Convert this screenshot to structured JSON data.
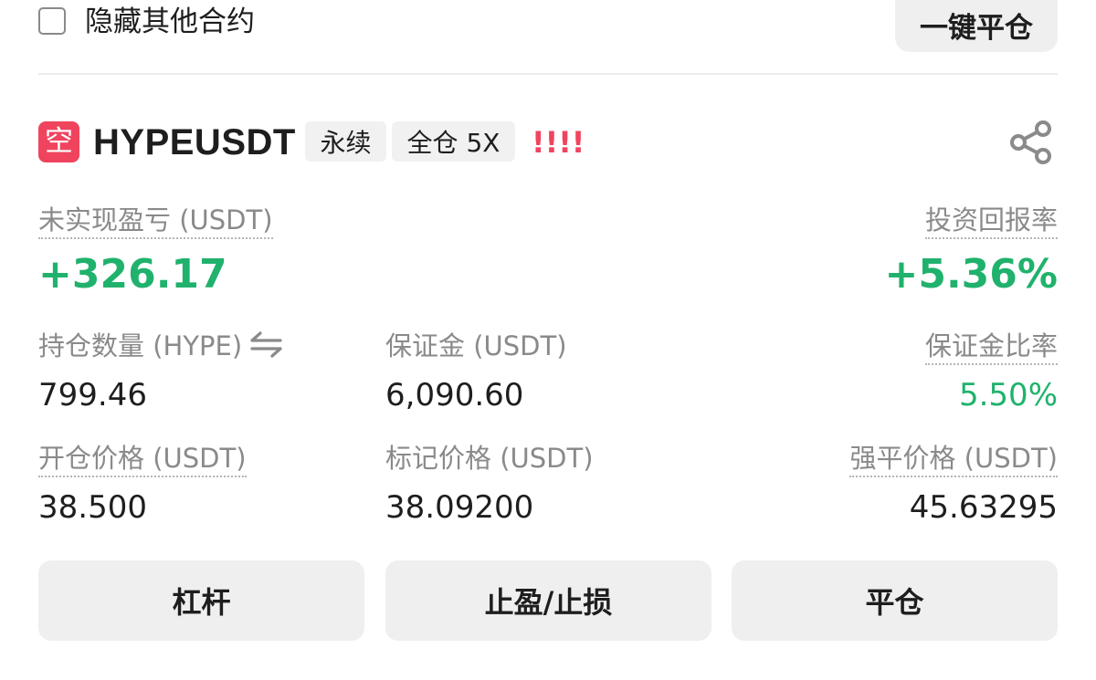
{
  "top_bar": {
    "hide_other_label": "隐藏其他合约",
    "close_all_label": "一键平仓"
  },
  "position": {
    "side_label": "空",
    "symbol": "HYPEUSDT",
    "contract_type": "永续",
    "margin_mode": "全仓 5X",
    "risk_indicator": "!!!!"
  },
  "metrics": {
    "unrealized_pnl_label": "未实现盈亏 (USDT)",
    "unrealized_pnl_value": "+326.17",
    "roi_label": "投资回报率",
    "roi_value": "+5.36%",
    "size_label": "持仓数量 (HYPE)",
    "size_value": "799.46",
    "margin_label": "保证金 (USDT)",
    "margin_value": "6,090.60",
    "margin_ratio_label": "保证金比率",
    "margin_ratio_value": "5.50%",
    "entry_price_label": "开仓价格 (USDT)",
    "entry_price_value": "38.500",
    "mark_price_label": "标记价格 (USDT)",
    "mark_price_value": "38.09200",
    "liq_price_label": "强平价格 (USDT)",
    "liq_price_value": "45.63295"
  },
  "actions": {
    "leverage_label": "杠杆",
    "tpsl_label": "止盈/止损",
    "close_label": "平仓"
  },
  "colors": {
    "profit_green": "#20b26c",
    "short_red": "#f0445e",
    "button_bg": "#efefef"
  },
  "icons": {
    "share": "share-icon",
    "swap": "swap-arrows-icon",
    "checkbox": "checkbox-unchecked"
  }
}
